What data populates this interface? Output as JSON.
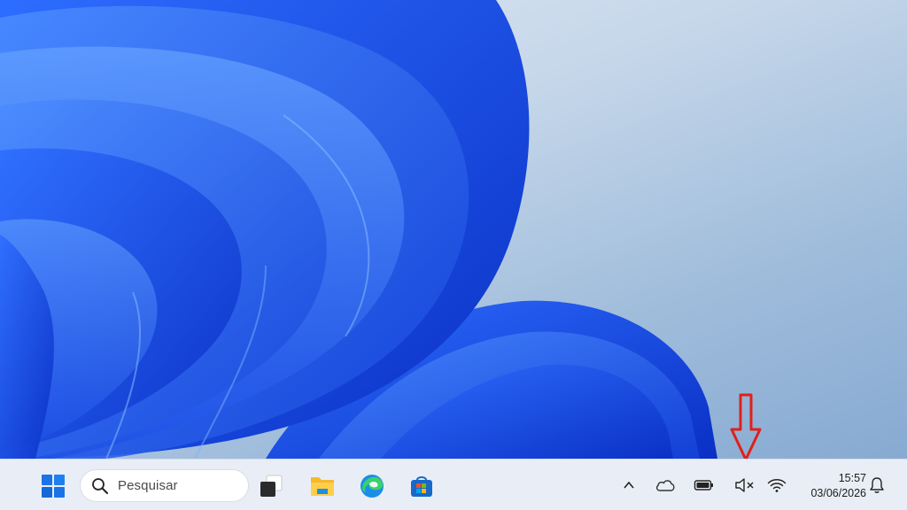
{
  "taskbar": {
    "search": {
      "placeholder": "Pesquisar"
    },
    "pinned_apps": [
      {
        "name": "Task View",
        "icon": "task-view-icon"
      },
      {
        "name": "File Explorer",
        "icon": "folder-icon"
      },
      {
        "name": "Microsoft Edge",
        "icon": "edge-icon"
      },
      {
        "name": "Microsoft Store",
        "icon": "store-icon"
      }
    ],
    "tray": {
      "icons": [
        "chevron-up-icon",
        "onedrive-cloud-icon",
        "battery-icon",
        "volume-muted-icon",
        "wifi-icon",
        "bell-icon"
      ],
      "clock": {
        "time": "15:57",
        "date": "03/06/2026"
      }
    }
  },
  "annotation": {
    "arrow_color": "#e0201b",
    "target": "volume-muted-icon"
  },
  "colors": {
    "taskbar_bg": "#e9eef6",
    "wallpaper_blue": "#1f56f0",
    "accent_blue": "#1a73e8"
  }
}
